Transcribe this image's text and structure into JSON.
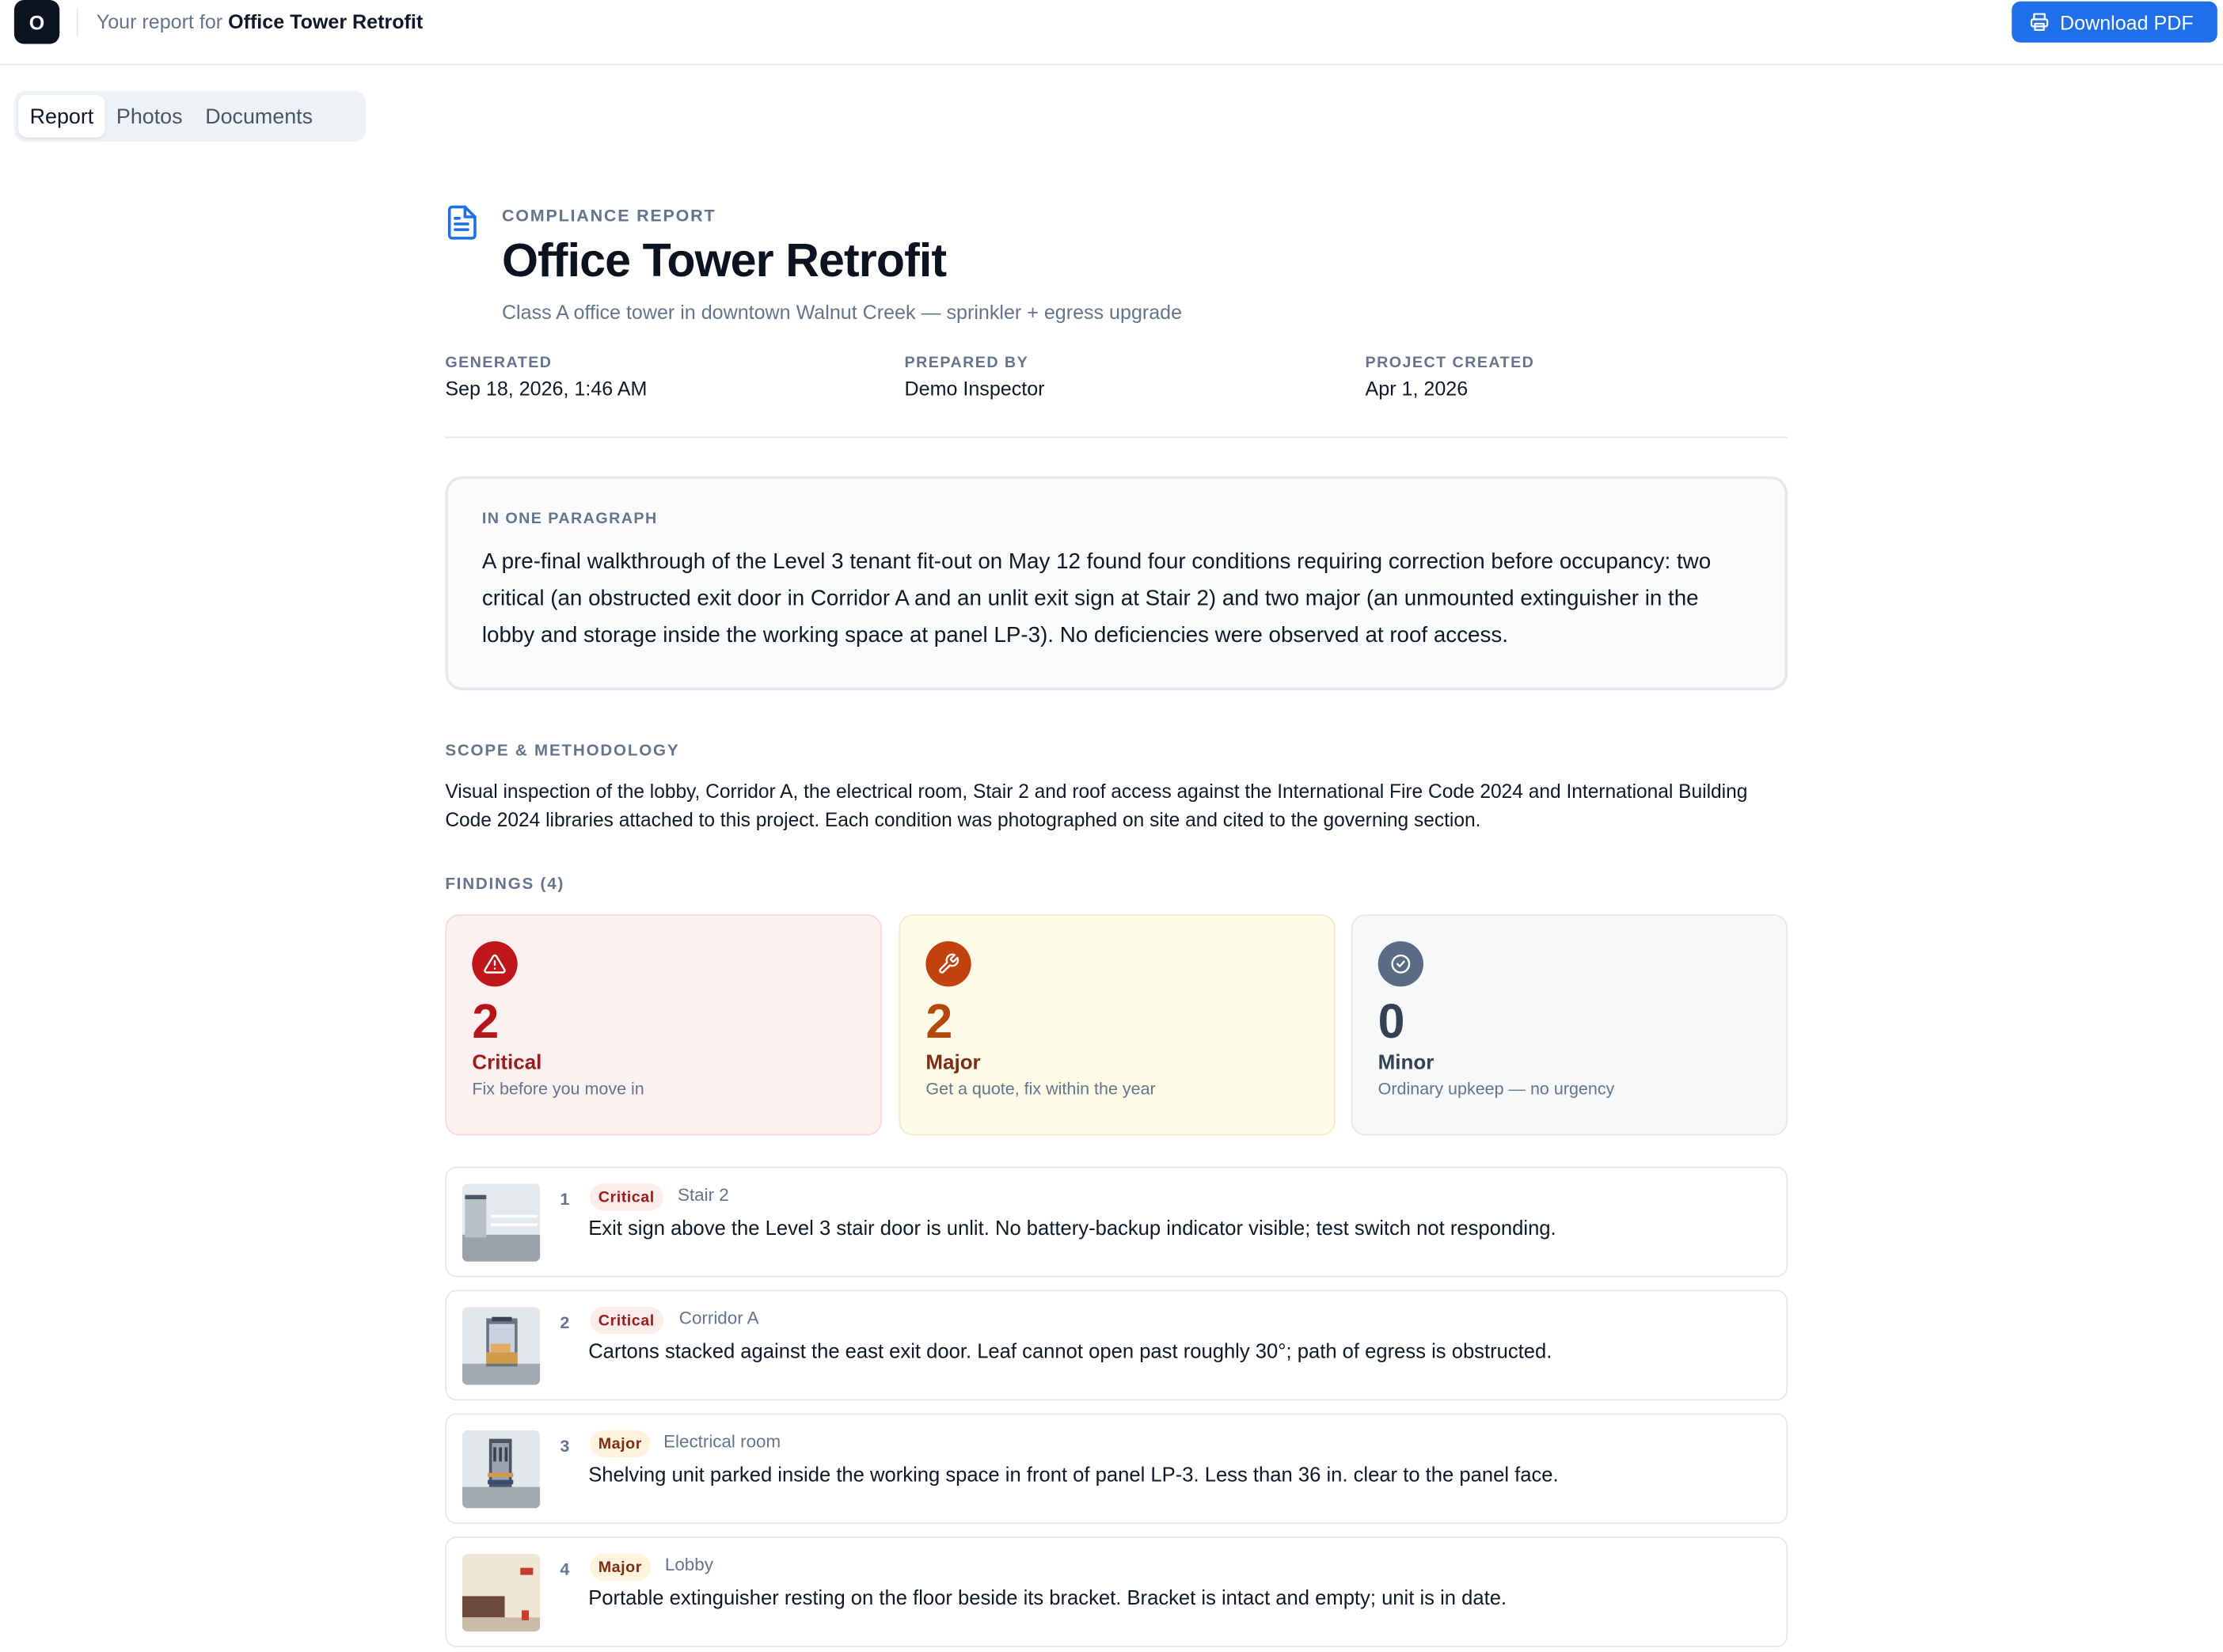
{
  "app": {
    "logo_letter": "O",
    "breadcrumb_prefix": "Your report for",
    "breadcrumb_project": "Office Tower Retrofit",
    "download_label": "Download PDF"
  },
  "tabs": [
    {
      "label": "Report",
      "active": true
    },
    {
      "label": "Photos",
      "active": false
    },
    {
      "label": "Documents",
      "active": false
    }
  ],
  "report": {
    "eyebrow": "COMPLIANCE REPORT",
    "title": "Office Tower Retrofit",
    "subtitle": "Class A office tower in downtown Walnut Creek — sprinkler + egress upgrade",
    "meta": [
      {
        "label": "GENERATED",
        "value": "Sep 18, 2026, 1:46 AM"
      },
      {
        "label": "PREPARED BY",
        "value": "Demo Inspector"
      },
      {
        "label": "PROJECT CREATED",
        "value": "Apr 1, 2026"
      }
    ],
    "summary_label": "IN ONE PARAGRAPH",
    "summary_text": "A pre-final walkthrough of the Level 3 tenant fit-out on May 12 found four conditions requiring correction before occupancy: two critical (an obstructed exit door in Corridor A and an unlit exit sign at Stair 2) and two major (an unmounted extinguisher in the lobby and storage inside the working space at panel LP-3). No deficiencies were observed at roof access.",
    "scope_label": "SCOPE & METHODOLOGY",
    "scope_text": "Visual inspection of the lobby, Corridor A, the electrical room, Stair 2 and roof access against the International Fire Code 2024 and International Building Code 2024 libraries attached to this project. Each condition was photographed on site and cited to the governing section.",
    "findings_label": "FINDINGS (4)"
  },
  "severity": [
    {
      "count": "2",
      "name": "Critical",
      "desc": "Fix before you move in",
      "icon": "warning-triangle-icon",
      "color": "#c0161b"
    },
    {
      "count": "2",
      "name": "Major",
      "desc": "Get a quote, fix within the year",
      "icon": "wrench-icon",
      "color": "#c2410c"
    },
    {
      "count": "0",
      "name": "Minor",
      "desc": "Ordinary upkeep — no urgency",
      "icon": "check-circle-icon",
      "color": "#5b6b84"
    }
  ],
  "findings": [
    {
      "num": "1",
      "severity": "Critical",
      "location": "Stair 2",
      "text": "Exit sign above the Level 3 stair door is unlit. No battery-backup indicator visible; test switch not responding."
    },
    {
      "num": "2",
      "severity": "Critical",
      "location": "Corridor A",
      "text": "Cartons stacked against the east exit door. Leaf cannot open past roughly 30°; path of egress is obstructed."
    },
    {
      "num": "3",
      "severity": "Major",
      "location": "Electrical room",
      "text": "Shelving unit parked inside the working space in front of panel LP-3. Less than 36 in. clear to the panel face."
    },
    {
      "num": "4",
      "severity": "Major",
      "location": "Lobby",
      "text": "Portable extinguisher resting on the floor beside its bracket. Bracket is intact and empty; unit is in date."
    }
  ]
}
